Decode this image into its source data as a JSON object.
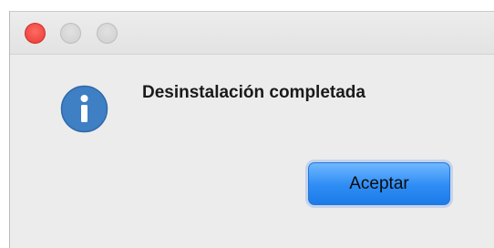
{
  "dialog": {
    "message": "Desinstalación completada",
    "icon": "info-icon",
    "accept_label": "Aceptar"
  },
  "titlebar": {
    "buttons": [
      "close",
      "minimize",
      "zoom"
    ]
  },
  "colors": {
    "close": "#f0473f",
    "accent": "#2e8cf4",
    "info_icon": "#3f7fc4"
  }
}
